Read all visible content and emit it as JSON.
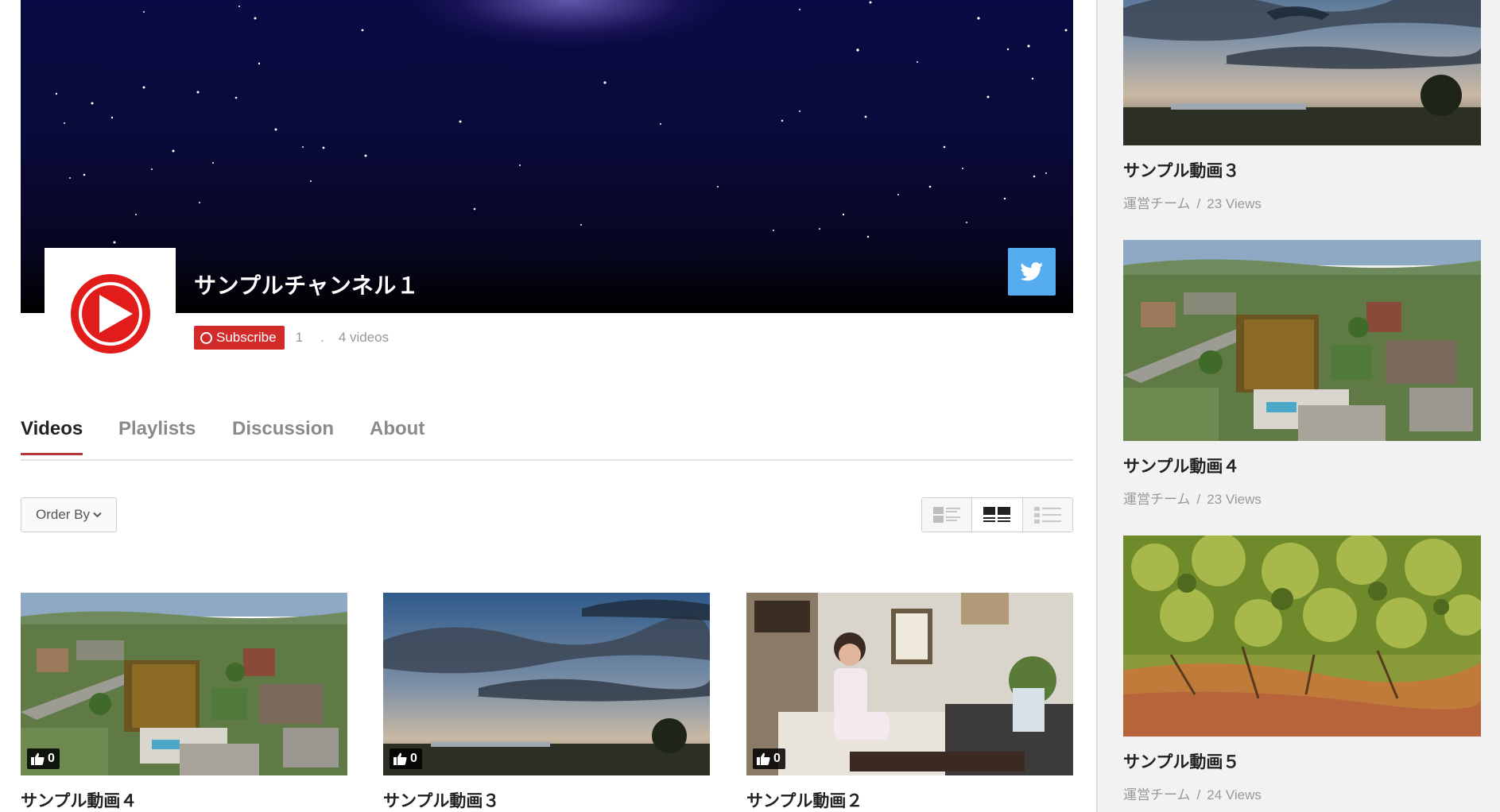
{
  "channel": {
    "name": "サンプルチャンネル１",
    "subscribe_label": "Subscribe",
    "subscriber_count": "1",
    "separator": ".",
    "video_count": "4 videos"
  },
  "tabs": [
    {
      "label": "Videos",
      "active": true
    },
    {
      "label": "Playlists",
      "active": false
    },
    {
      "label": "Discussion",
      "active": false
    },
    {
      "label": "About",
      "active": false
    }
  ],
  "toolbar": {
    "order_by_label": "Order By",
    "views": [
      "list-with-thumbs",
      "grid",
      "list-compact"
    ],
    "active_view": "grid"
  },
  "videos": [
    {
      "title": "サンプル動画４",
      "likes": "0",
      "thumbnail": "aerial-city"
    },
    {
      "title": "サンプル動画３",
      "likes": "0",
      "thumbnail": "cloudy-sky"
    },
    {
      "title": "サンプル動画２",
      "likes": "0",
      "thumbnail": "woman-cafe"
    }
  ],
  "sidebar": {
    "items": [
      {
        "title": "サンプル動画３",
        "author": "運営チーム",
        "sep": "/",
        "views": "23 Views",
        "thumbnail": "cloudy-sky"
      },
      {
        "title": "サンプル動画４",
        "author": "運営チーム",
        "sep": "/",
        "views": "23 Views",
        "thumbnail": "aerial-city"
      },
      {
        "title": "サンプル動画５",
        "author": "運営チーム",
        "sep": "/",
        "views": "24 Views",
        "thumbnail": "green-shrub"
      }
    ]
  },
  "colors": {
    "accent": "#b73a3a",
    "subscribe": "#d32a2a",
    "twitter": "#55acee",
    "sidebar_bg": "#f2f2f2"
  },
  "icons": {
    "twitter": "twitter-bird-icon",
    "play_logo": "play-logo-icon",
    "like": "thumbs-up-icon",
    "dropdown": "chevron-down-icon"
  }
}
